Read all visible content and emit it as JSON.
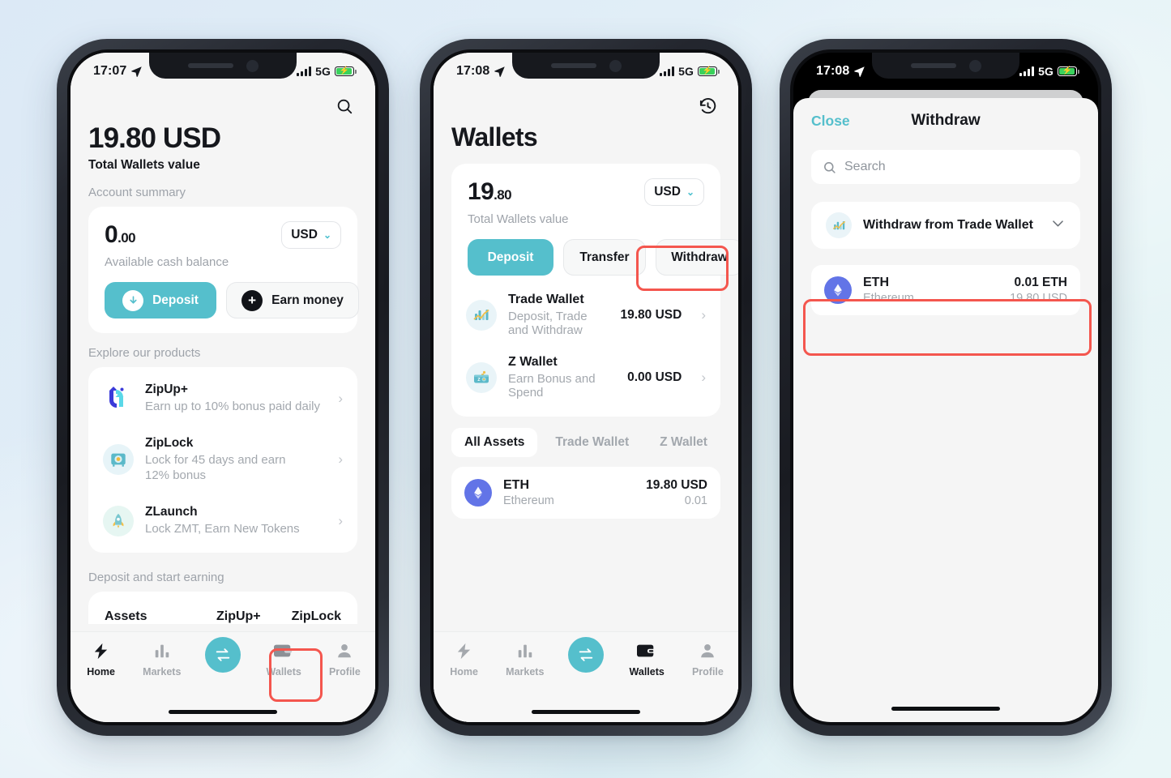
{
  "background": {
    "from": "#dce9f6",
    "to": "#e9f6f7"
  },
  "accent": {
    "teal": "#55bfcc",
    "highlight": "#f4564e",
    "eth": "#6274e7"
  },
  "phone1": {
    "status": {
      "time": "17:07",
      "network": "5G",
      "location_icon": "location-arrow-icon",
      "battery_icon": "battery-charging-icon"
    },
    "search_icon": "search-icon",
    "total_amount": "19.80 USD",
    "total_label": "Total Wallets value",
    "account_summary_label": "Account summary",
    "cash": {
      "amount_int": "0",
      "amount_cents": ".00",
      "currency": "USD",
      "label": "Available cash balance",
      "deposit_label": "Deposit",
      "earn_label": "Earn money"
    },
    "explore_label": "Explore our products",
    "products": [
      {
        "title": "ZipUp+",
        "desc": "Earn up to 10% bonus paid daily",
        "icon": "zipup-logo-icon"
      },
      {
        "title": "ZipLock",
        "desc": "Lock for 45 days and earn 12% bonus",
        "icon": "safe-lock-icon"
      },
      {
        "title": "ZLaunch",
        "desc": "Lock ZMT, Earn New Tokens",
        "icon": "rocket-icon"
      }
    ],
    "deposit_earning_label": "Deposit and start earning",
    "peek_tabs": [
      "Assets",
      "ZipUp+",
      "ZipLock"
    ],
    "tabbar": [
      {
        "label": "Home",
        "icon": "bolt-icon",
        "active": true
      },
      {
        "label": "Markets",
        "icon": "bar-chart-icon",
        "active": false
      },
      {
        "label": "",
        "icon": "swap-icon",
        "active": false
      },
      {
        "label": "Wallets",
        "icon": "wallet-icon",
        "active": false
      },
      {
        "label": "Profile",
        "icon": "person-icon",
        "active": false
      }
    ],
    "highlight_target": "Wallets"
  },
  "phone2": {
    "status": {
      "time": "17:08",
      "network": "5G"
    },
    "history_icon": "history-clock-icon",
    "page_title": "Wallets",
    "total": {
      "int": "19",
      "cents": ".80",
      "currency": "USD",
      "label": "Total Wallets value"
    },
    "actions": [
      {
        "label": "Deposit",
        "style": "primary"
      },
      {
        "label": "Transfer",
        "style": "outline"
      },
      {
        "label": "Withdraw",
        "style": "outline",
        "highlighted": true
      }
    ],
    "wallets": [
      {
        "name": "Trade Wallet",
        "desc": "Deposit, Trade and Withdraw",
        "amount": "19.80 USD",
        "icon": "trade-chart-icon"
      },
      {
        "name": "Z Wallet",
        "desc": "Earn Bonus and Spend",
        "amount": "0.00 USD",
        "icon": "z-wallet-icon"
      }
    ],
    "segments": [
      {
        "label": "All Assets",
        "active": true
      },
      {
        "label": "Trade Wallet",
        "active": false
      },
      {
        "label": "Z Wallet",
        "active": false
      }
    ],
    "assets": [
      {
        "symbol": "ETH",
        "name": "Ethereum",
        "value": "19.80 USD",
        "qty": "0.01",
        "icon": "ethereum-icon"
      }
    ],
    "tabbar": [
      {
        "label": "Home",
        "icon": "bolt-icon",
        "active": false
      },
      {
        "label": "Markets",
        "icon": "bar-chart-icon",
        "active": false
      },
      {
        "label": "",
        "icon": "swap-icon",
        "active": false
      },
      {
        "label": "Wallets",
        "icon": "wallet-icon",
        "active": true
      },
      {
        "label": "Profile",
        "icon": "person-icon",
        "active": false
      }
    ]
  },
  "phone3": {
    "status": {
      "time": "17:08",
      "network": "5G"
    },
    "close_label": "Close",
    "title": "Withdraw",
    "search_placeholder": "Search",
    "search_value": "",
    "source_selector": {
      "label": "Withdraw from Trade Wallet",
      "icon": "trade-chart-icon",
      "chevron": "chevron-down-icon"
    },
    "assets": [
      {
        "symbol": "ETH",
        "name": "Ethereum",
        "qty": "0.01 ETH",
        "value": "19.80 USD",
        "icon": "ethereum-icon",
        "highlighted": true
      }
    ]
  }
}
